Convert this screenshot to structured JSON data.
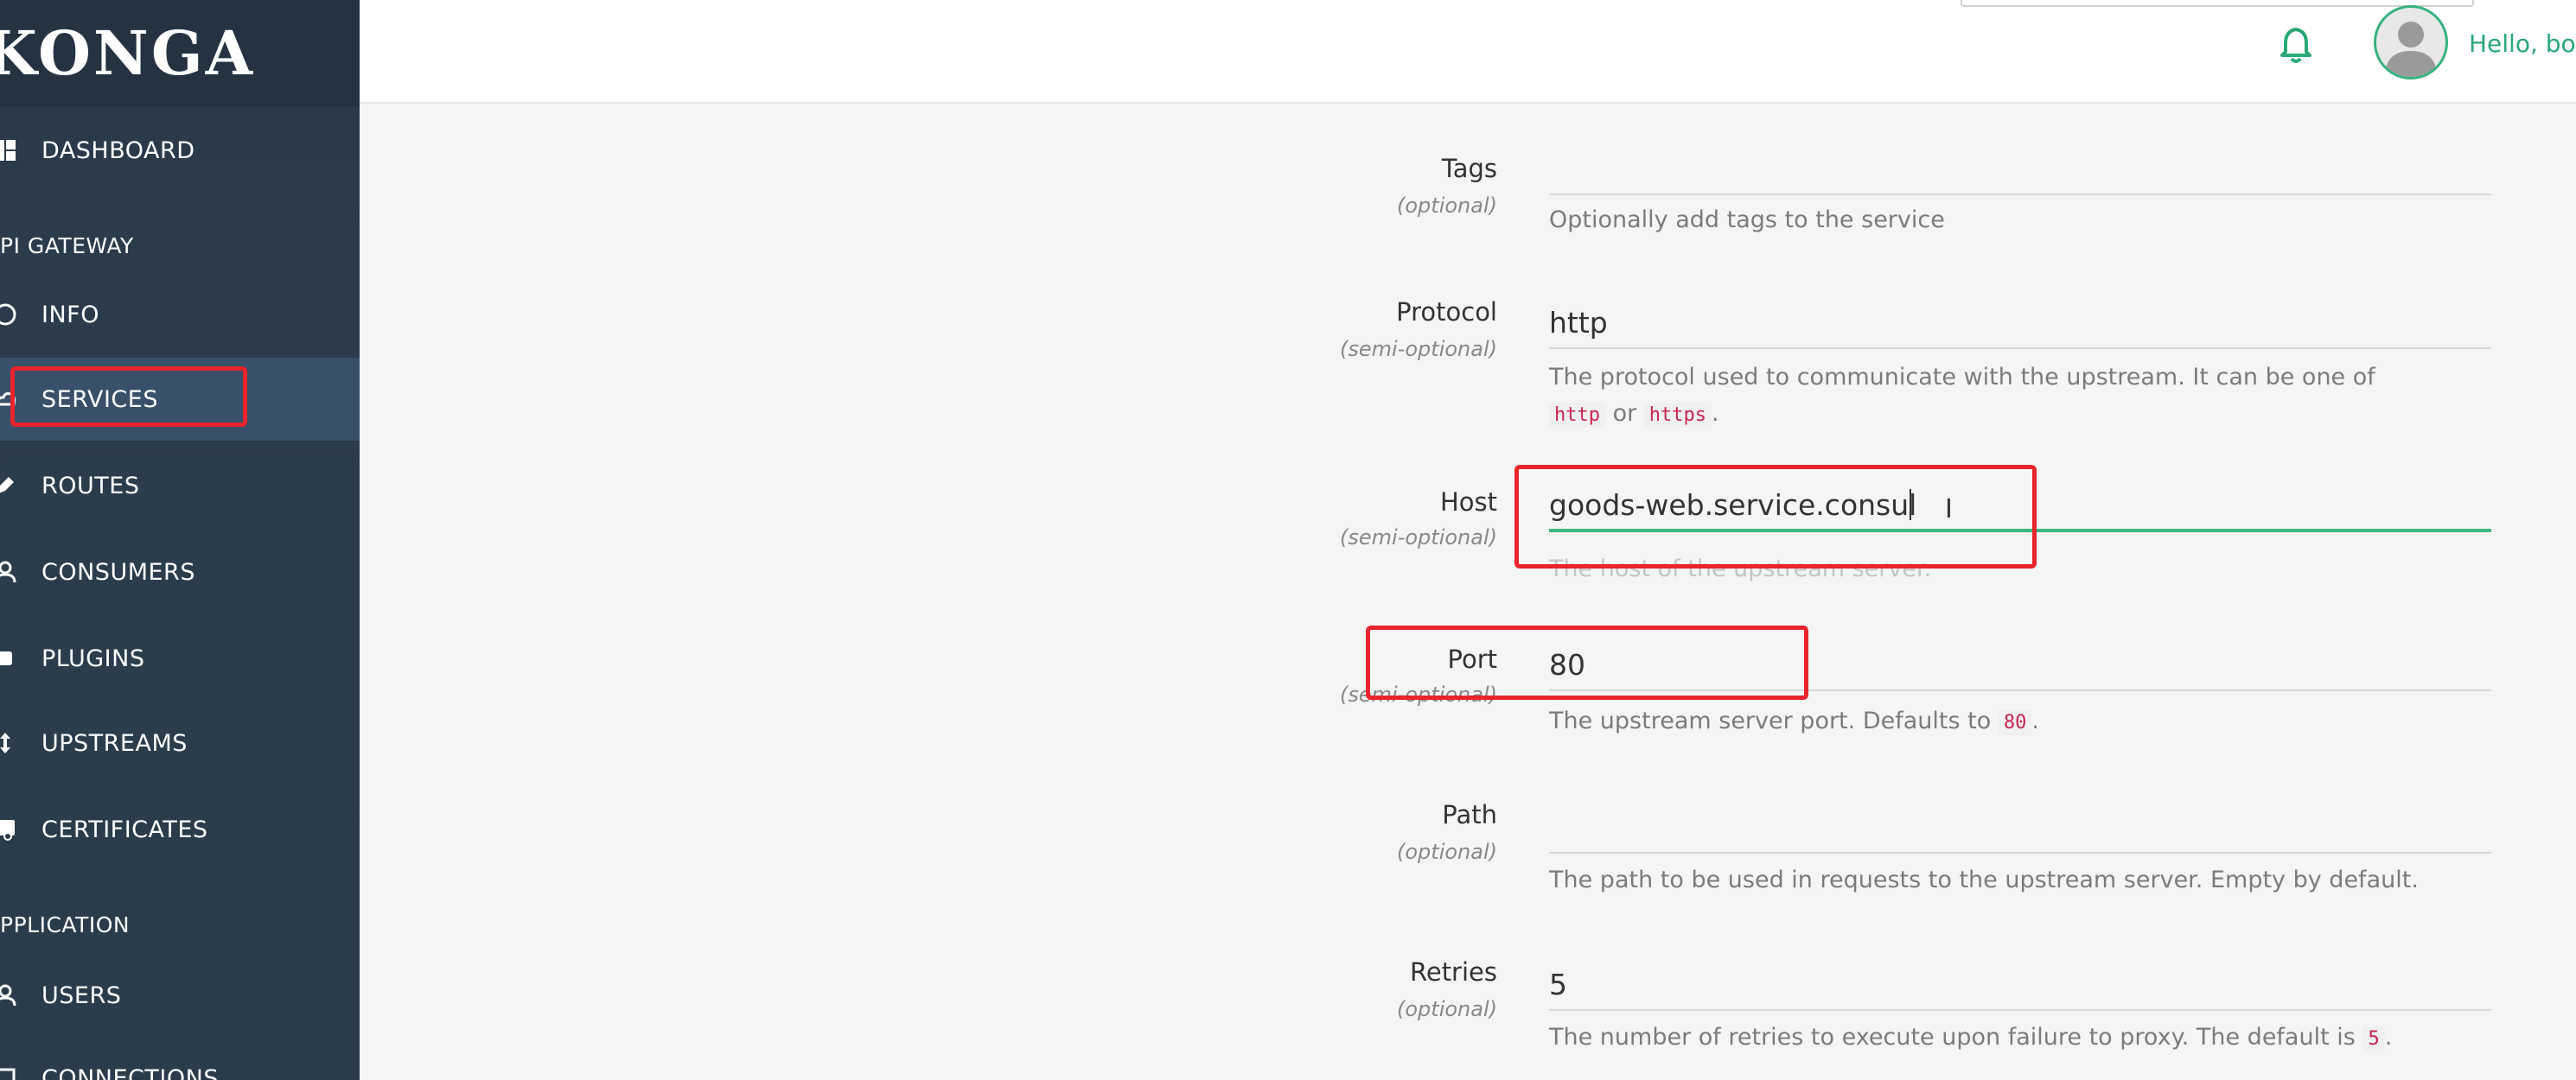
{
  "sidebar": {
    "brand": "KONGA",
    "dashboard": "DASHBOARD",
    "api_gateway_section": "PI GATEWAY",
    "items": [
      {
        "label": "INFO"
      },
      {
        "label": "SERVICES"
      },
      {
        "label": "ROUTES"
      },
      {
        "label": "CONSUMERS"
      },
      {
        "label": "PLUGINS"
      },
      {
        "label": "UPSTREAMS"
      },
      {
        "label": "CERTIFICATES"
      }
    ],
    "application_section": "PPLICATION",
    "app_items": [
      {
        "label": "USERS"
      },
      {
        "label": "CONNECTIONS"
      }
    ]
  },
  "topbar": {
    "greeting": "Hello, bo",
    "bell_icon": "bell-icon",
    "avatar_icon": "user-avatar-icon"
  },
  "form": {
    "tags": {
      "label": "Tags",
      "sub": "(optional)",
      "value": "",
      "help": "Optionally add tags to the service"
    },
    "protocol": {
      "label": "Protocol",
      "sub": "(semi-optional)",
      "value": "http",
      "help_prefix": "The protocol used to communicate with the upstream. It can be one of",
      "code1": "http",
      "mid": "or",
      "code2": "https",
      "end": "."
    },
    "host": {
      "label": "Host",
      "sub": "(semi-optional)",
      "value": "goods-web.service.consul",
      "help": "The host of the upstream server."
    },
    "port": {
      "label": "Port",
      "sub": "(semi-optional)",
      "value": "80",
      "help_prefix": "The upstream server port. Defaults to",
      "code": "80",
      "end": "."
    },
    "path": {
      "label": "Path",
      "sub": "(optional)",
      "value": "",
      "help": "The path to be used in requests to the upstream server. Empty by default."
    },
    "retries": {
      "label": "Retries",
      "sub": "(optional)",
      "value": "5",
      "help_prefix": "The number of retries to execute upon failure to proxy. The default is",
      "code": "5",
      "end": "."
    }
  },
  "colors": {
    "sidebar_bg": "#2b3a4a",
    "active_item": "#38506a",
    "accent_green": "#3bb57a",
    "annotation_red": "#e8242c"
  }
}
